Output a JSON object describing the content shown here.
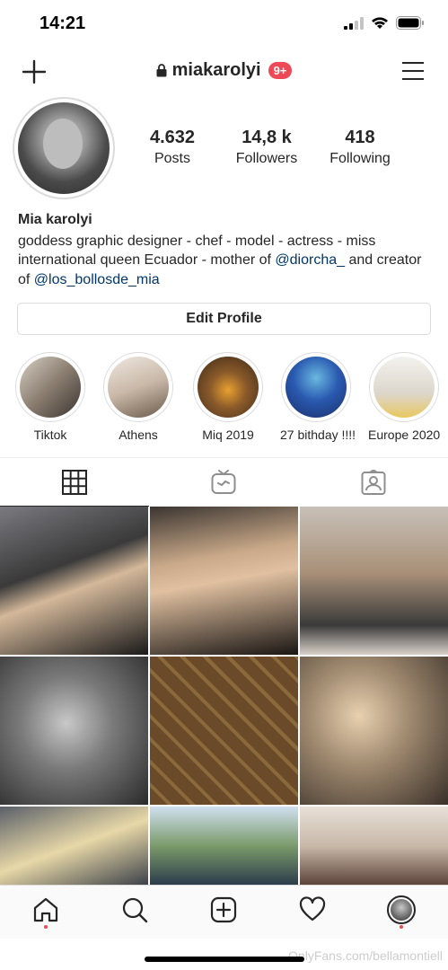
{
  "status_bar": {
    "time": "14:21"
  },
  "nav": {
    "username": "miakarolyi",
    "notif_badge": "9+"
  },
  "profile": {
    "stats": [
      {
        "value": "4.632",
        "label": "Posts"
      },
      {
        "value": "14,8 k",
        "label": "Followers"
      },
      {
        "value": "418",
        "label": "Following"
      }
    ],
    "name": "Mia karolyi",
    "bio_line1": "goddess graphic designer - chef - model - actress - miss international queen Ecuador - mother of ",
    "bio_mention1": "@diorcha_",
    "bio_mid": " and creator of ",
    "bio_mention2": "@los_bollosde_mia",
    "edit_button": "Edit Profile"
  },
  "highlights": [
    {
      "label": "Tiktok",
      "color": "#8a7d70"
    },
    {
      "label": "Athens",
      "color": "#c9b8a8"
    },
    {
      "label": "Miq 2019",
      "color": "#5a3d2a"
    },
    {
      "label": "27 bithday !!!!",
      "color": "#1e3f8a"
    },
    {
      "label": "Europe 2020",
      "color": "#e8e4dc"
    }
  ],
  "grid_colors": [
    "#3a3a3a",
    "#2c2420",
    "#b8a898",
    "#6a6a6a",
    "#6b4a2a",
    "#5a4a3a",
    "#3a4048",
    "#7a9a6a",
    "#c8b8a8"
  ],
  "watermark": "OnlyFans.com/bellamontiell"
}
